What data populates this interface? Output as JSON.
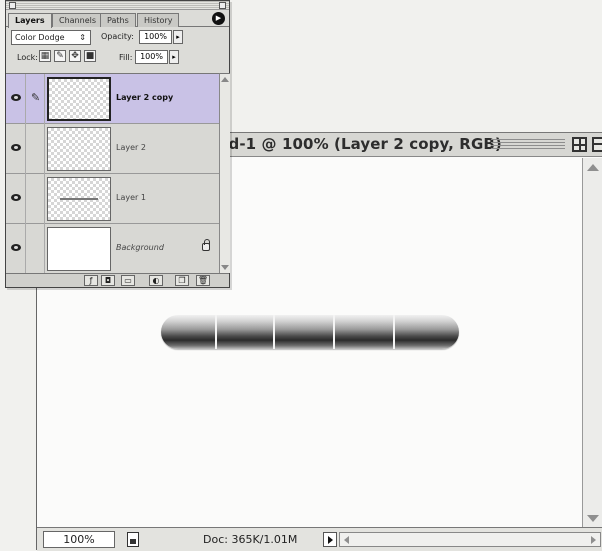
{
  "document": {
    "title": "led-1 @ 100% (Layer 2 copy, RGB)",
    "zoom": "100%",
    "doc_info": "Doc: 365K/1.01M"
  },
  "layers_panel": {
    "tabs": [
      {
        "label": "Layers",
        "active": true
      },
      {
        "label": "Channels",
        "active": false
      },
      {
        "label": "Paths",
        "active": false
      },
      {
        "label": "History",
        "active": false
      }
    ],
    "blend_mode": "Color Dodge",
    "opacity_label": "Opacity:",
    "opacity_value": "100%",
    "lock_label": "Lock:",
    "fill_label": "Fill:",
    "fill_value": "100%",
    "layers": [
      {
        "name": "Layer 2 copy",
        "selected": true,
        "visible": true
      },
      {
        "name": "Layer 2",
        "selected": false,
        "visible": true
      },
      {
        "name": "Layer 1",
        "selected": false,
        "visible": true
      },
      {
        "name": "Background",
        "selected": false,
        "visible": true,
        "locked": true
      }
    ]
  },
  "colors": {
    "selected_layer": "#c9c2e6",
    "panel_bg": "#dcdcd8",
    "canvas_bg": "#fbfbfa"
  }
}
